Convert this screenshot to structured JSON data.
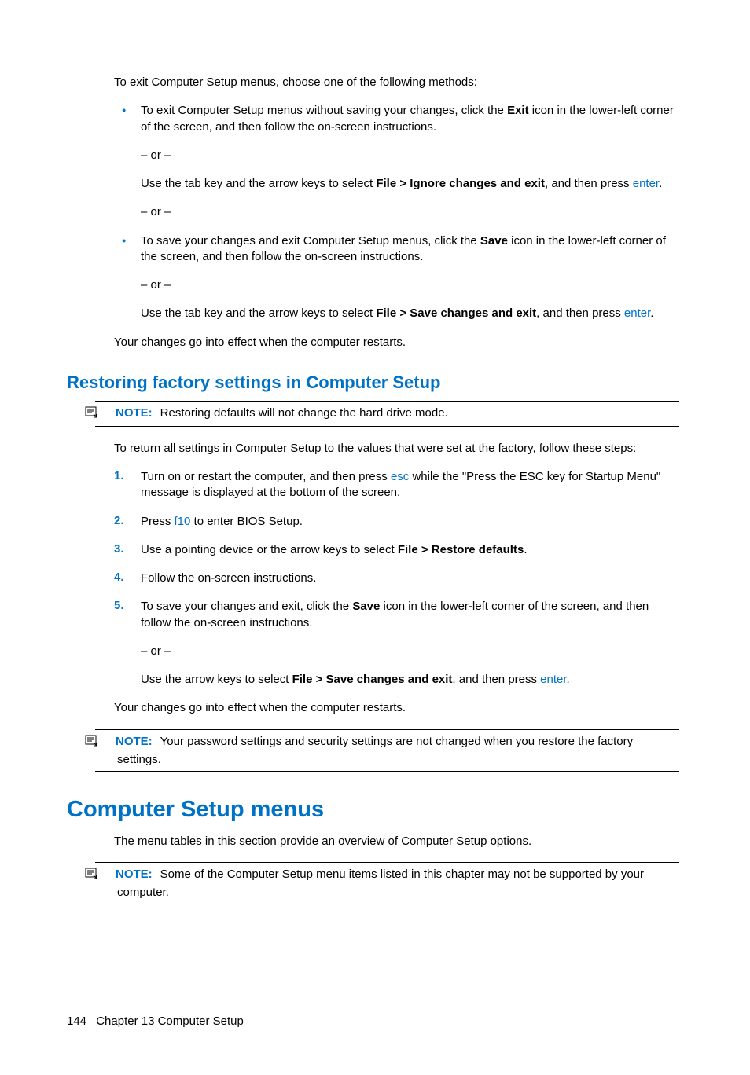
{
  "intro": "To exit Computer Setup menus, choose one of the following methods:",
  "b1": {
    "p1a": "To exit Computer Setup menus without saving your changes, click the ",
    "p1b": "Exit",
    "p1c": " icon in the lower-left corner of the screen, and then follow the on-screen instructions.",
    "or": "– or –",
    "p2a": "Use the tab key and the arrow keys to select ",
    "p2b": "File > Ignore changes and exit",
    "p2c": ", and then press ",
    "p2d": "enter",
    "p2e": "."
  },
  "b2": {
    "p1a": "To save your changes and exit Computer Setup menus, click the ",
    "p1b": "Save",
    "p1c": " icon in the lower-left corner of the screen, and then follow the on-screen instructions.",
    "or": "– or –",
    "p2a": "Use the tab key and the arrow keys to select ",
    "p2b": "File > Save changes and exit",
    "p2c": ", and then press ",
    "p2d": "enter",
    "p2e": "."
  },
  "afterBullets": "Your changes go into effect when the computer restarts.",
  "h2": "Restoring factory settings in Computer Setup",
  "note1": {
    "label": "NOTE:",
    "text": "Restoring defaults will not change the hard drive mode."
  },
  "restoreIntro": "To return all settings in Computer Setup to the values that were set at the factory, follow these steps:",
  "steps": {
    "s1": {
      "num": "1.",
      "a": "Turn on or restart the computer, and then press ",
      "b": "esc",
      "c": " while the \"Press the ESC key for Startup Menu\" message is displayed at the bottom of the screen."
    },
    "s2": {
      "num": "2.",
      "a": "Press ",
      "b": "f10",
      "c": " to enter BIOS Setup."
    },
    "s3": {
      "num": "3.",
      "a": "Use a pointing device or the arrow keys to select ",
      "b": "File > Restore defaults",
      "c": "."
    },
    "s4": {
      "num": "4.",
      "a": "Follow the on-screen instructions."
    },
    "s5": {
      "num": "5.",
      "a": "To save your changes and exit, click the ",
      "b": "Save",
      "c": " icon in the lower-left corner of the screen, and then follow the on-screen instructions.",
      "or": "– or –",
      "d": "Use the arrow keys to select ",
      "e": "File > Save changes and exit",
      "f": ", and then press ",
      "g": "enter",
      "h": "."
    }
  },
  "afterSteps": "Your changes go into effect when the computer restarts.",
  "note2": {
    "label": "NOTE:",
    "text": "Your password settings and security settings are not changed when you restore the factory settings."
  },
  "h1": "Computer Setup menus",
  "menusIntro": "The menu tables in this section provide an overview of Computer Setup options.",
  "note3": {
    "label": "NOTE:",
    "text": "Some of the Computer Setup menu items listed in this chapter may not be supported by your computer."
  },
  "footer": {
    "page": "144",
    "chapter": "Chapter 13   Computer Setup"
  }
}
